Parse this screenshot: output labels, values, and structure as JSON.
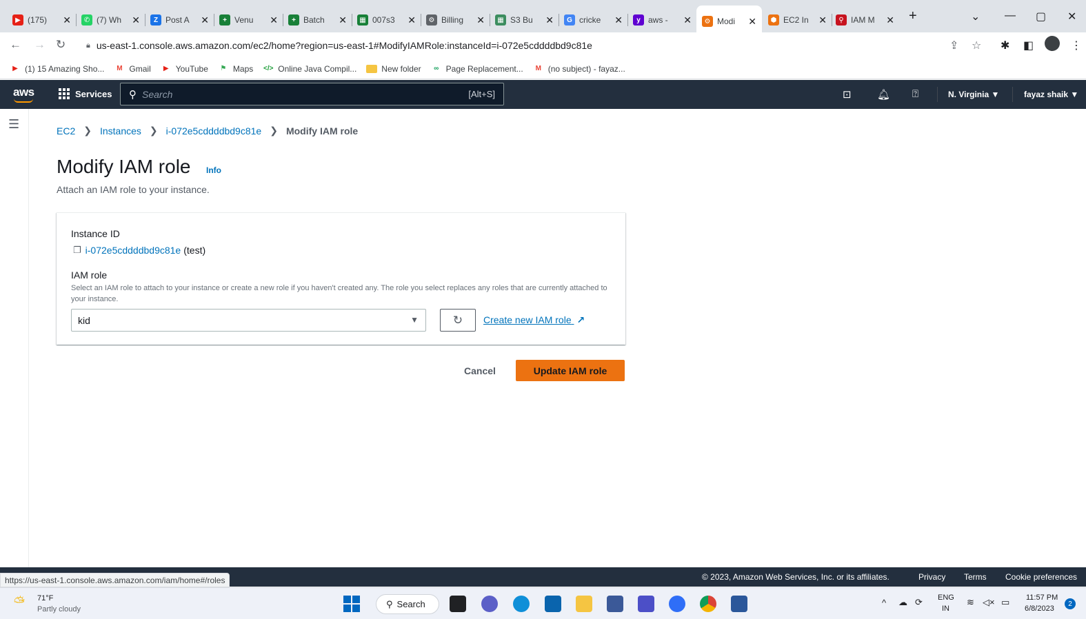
{
  "browser": {
    "tabs": [
      {
        "label": "(175)",
        "color": "#e62117",
        "glyph": "▶"
      },
      {
        "label": "(7) Wh",
        "color": "#25d366",
        "glyph": "✆"
      },
      {
        "label": "Post A",
        "color": "#1a73e8",
        "glyph": "Z"
      },
      {
        "label": "Venu",
        "color": "#188038",
        "glyph": "+"
      },
      {
        "label": "Batch",
        "color": "#188038",
        "glyph": "+"
      },
      {
        "label": "007s3",
        "color": "#188038",
        "glyph": "▦"
      },
      {
        "label": "Billing",
        "color": "#5f6368",
        "glyph": "⚙"
      },
      {
        "label": "S3 Bu",
        "color": "#3c8d5f",
        "glyph": "▦"
      },
      {
        "label": "cricke",
        "color": "#4285f4",
        "glyph": "G"
      },
      {
        "label": "aws -",
        "color": "#5f01d1",
        "glyph": "y"
      },
      {
        "label": "Modi",
        "color": "#ec7211",
        "glyph": "⚙",
        "active": true
      },
      {
        "label": "EC2 In",
        "color": "#ec7211",
        "glyph": "⬢"
      },
      {
        "label": "IAM M",
        "color": "#c7131f",
        "glyph": "⚲"
      }
    ],
    "new_tab": "+",
    "url": "us-east-1.console.aws.amazon.com/ec2/home?region=us-east-1#ModifyIAMRole:instanceId=i-072e5cddddbd9c81e",
    "bookmarks": [
      {
        "label": "(1) 15 Amazing Sho...",
        "color": "#e62117",
        "glyph": "▶"
      },
      {
        "label": "Gmail",
        "color": "#ea4335",
        "glyph": "M"
      },
      {
        "label": "YouTube",
        "color": "#e62117",
        "glyph": "▶"
      },
      {
        "label": "Maps",
        "color": "#34a853",
        "glyph": "⚑"
      },
      {
        "label": "Online Java Compil...",
        "color": "#1a9c36",
        "glyph": "</>"
      },
      {
        "label": "New folder",
        "color": "#f5c542",
        "glyph": ""
      },
      {
        "label": "Page Replacement...",
        "color": "#0f9d58",
        "glyph": "∞"
      },
      {
        "label": "(no subject) - fayaz...",
        "color": "#ea4335",
        "glyph": "M"
      }
    ],
    "status_url": "https://us-east-1.console.aws.amazon.com/iam/home#/roles"
  },
  "aws_header": {
    "logo": "aws",
    "services_label": "Services",
    "search_placeholder": "Search",
    "search_shortcut": "[Alt+S]",
    "region": "N. Virginia ▼",
    "user": "fayaz shaik ▼"
  },
  "breadcrumbs": [
    {
      "label": "EC2",
      "link": true
    },
    {
      "label": "Instances",
      "link": true
    },
    {
      "label": "i-072e5cddddbd9c81e",
      "link": true
    },
    {
      "label": "Modify IAM role",
      "link": false
    }
  ],
  "page": {
    "title": "Modify IAM role",
    "info": "Info",
    "subtitle": "Attach an IAM role to your instance."
  },
  "form": {
    "instance_id_label": "Instance ID",
    "instance_id": "i-072e5cddddbd9c81e",
    "instance_name": "(test)",
    "iam_role_label": "IAM role",
    "iam_role_description": "Select an IAM role to attach to your instance or create a new role if you haven't created any. The role you select replaces any roles that are currently attached to your instance.",
    "iam_role_value": "kid",
    "create_role_label": "Create new IAM role"
  },
  "actions": {
    "cancel": "Cancel",
    "update": "Update IAM role"
  },
  "footer": {
    "copyright": "© 2023, Amazon Web Services, Inc. or its affiliates.",
    "privacy": "Privacy",
    "terms": "Terms",
    "cookies": "Cookie preferences"
  },
  "taskbar": {
    "weather_temp": "71°F",
    "weather_desc": "Partly cloudy",
    "search_label": "Search",
    "lang_top": "ENG",
    "lang_bottom": "IN",
    "time": "11:57 PM",
    "date": "6/8/2023",
    "notif_count": "2"
  },
  "colors": {
    "aws_nav": "#232f3e",
    "primary_button": "#ec7211",
    "link": "#0073bb"
  }
}
